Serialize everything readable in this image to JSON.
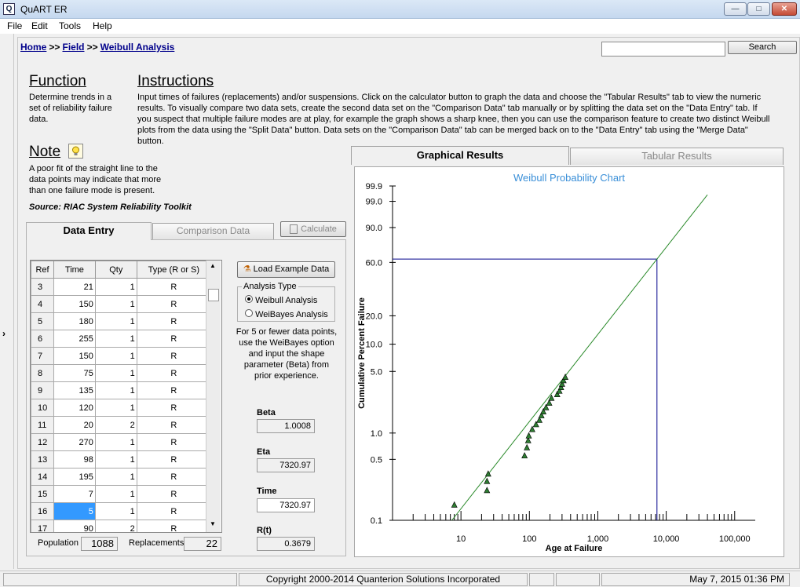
{
  "window": {
    "title": "QuART ER",
    "icon_letter": "Q",
    "minimize_glyph": "—",
    "maximize_glyph": "□",
    "close_glyph": "✕"
  },
  "menu": [
    "File",
    "Edit",
    "Tools",
    "Help"
  ],
  "breadcrumb": {
    "home": "Home",
    "field": "Field",
    "current": "Weibull Analysis",
    "separator": ">>"
  },
  "search": {
    "value": "",
    "button_label": "Search"
  },
  "function": {
    "heading": "Function",
    "text": "Determine trends in a set of reliability failure data."
  },
  "instructions": {
    "heading": "Instructions",
    "text": "Input times of failures (replacements) and/or suspensions. Click on the calculator button to graph the data and choose the \"Tabular Results\" tab to  view the numeric results. To visually compare two data sets, create the second data set on the \"Comparison Data\" tab manually or by splitting the data set on the \"Data Entry\" tab. If you suspect that multiple failure modes are at play, for example the graph shows a sharp knee, then you can use the comparison feature to create two distinct Weibull plots from the data using the \"Split Data\" button. Data sets on the \"Comparison Data\" tab can be merged back on to the \"Data Entry\" tab using the \"Merge Data\" button."
  },
  "note": {
    "heading": "Note",
    "text": "A poor fit of the straight line to the data points may indicate that more than one failure mode is present.",
    "source": "Source: RIAC System Reliability Toolkit"
  },
  "left_tabs": {
    "data_entry": "Data Entry",
    "comparison": "Comparison Data",
    "calculate": "Calculate"
  },
  "table": {
    "headers": [
      "Ref",
      "Time",
      "Qty",
      "Type (R or S)"
    ],
    "rows": [
      [
        "3",
        "21",
        "1",
        "R"
      ],
      [
        "4",
        "150",
        "1",
        "R"
      ],
      [
        "5",
        "180",
        "1",
        "R"
      ],
      [
        "6",
        "255",
        "1",
        "R"
      ],
      [
        "7",
        "150",
        "1",
        "R"
      ],
      [
        "8",
        "75",
        "1",
        "R"
      ],
      [
        "9",
        "135",
        "1",
        "R"
      ],
      [
        "10",
        "120",
        "1",
        "R"
      ],
      [
        "11",
        "20",
        "2",
        "R"
      ],
      [
        "12",
        "270",
        "1",
        "R"
      ],
      [
        "13",
        "98",
        "1",
        "R"
      ],
      [
        "14",
        "195",
        "1",
        "R"
      ],
      [
        "15",
        "7",
        "1",
        "R"
      ],
      [
        "16",
        "5",
        "1",
        "R"
      ],
      [
        "17",
        "90",
        "2",
        "R"
      ]
    ],
    "selected_ref": "16"
  },
  "population": {
    "label": "Population",
    "value": "1088"
  },
  "replacements": {
    "label": "Replacements",
    "value": "22"
  },
  "load_example": "Load Example Data",
  "analysis_type": {
    "legend": "Analysis Type",
    "options": [
      "Weibull Analysis",
      "WeiBayes Analysis"
    ],
    "selected": "Weibull Analysis"
  },
  "weibayes_hint": "For 5 or fewer data points, use the WeiBayes option and input the shape parameter (Beta) from prior experience.",
  "results": {
    "beta": {
      "label": "Beta",
      "value": "1.0008"
    },
    "eta": {
      "label": "Eta",
      "value": "7320.97"
    },
    "time": {
      "label": "Time",
      "value": "7320.97"
    },
    "rt": {
      "label": "R(t)",
      "value": "0.3679"
    }
  },
  "right_tabs": {
    "graphical": "Graphical Results",
    "tabular": "Tabular Results"
  },
  "chart_data": {
    "type": "scatter",
    "title": "Weibull Probability Chart",
    "xlabel": "Age at Failure",
    "ylabel": "Cumulative Percent Failure",
    "x_scale": "log",
    "y_scale": "weibull",
    "xlim": [
      1,
      200000
    ],
    "ylim": [
      0.1,
      99.9
    ],
    "x_ticks": [
      {
        "v": 10,
        "l": "10"
      },
      {
        "v": 100,
        "l": "100"
      },
      {
        "v": 1000,
        "l": "1,000"
      },
      {
        "v": 10000,
        "l": "10,000"
      },
      {
        "v": 100000,
        "l": "100,000"
      }
    ],
    "y_ticks": [
      {
        "v": 99.9,
        "l": "99.9"
      },
      {
        "v": 99.0,
        "l": "99.0"
      },
      {
        "v": 90.0,
        "l": "90.0"
      },
      {
        "v": 60.0,
        "l": "60.0"
      },
      {
        "v": 20.0,
        "l": "20.0"
      },
      {
        "v": 10.0,
        "l": "10.0"
      },
      {
        "v": 5.0,
        "l": "5.0"
      },
      {
        "v": 1.0,
        "l": "1.0"
      },
      {
        "v": 0.5,
        "l": "0.5"
      },
      {
        "v": 0.1,
        "l": "0.1"
      }
    ],
    "points": [
      {
        "x": 8,
        "y": 0.15
      },
      {
        "x": 24,
        "y": 0.22
      },
      {
        "x": 24,
        "y": 0.28
      },
      {
        "x": 25,
        "y": 0.34
      },
      {
        "x": 85,
        "y": 0.55
      },
      {
        "x": 92,
        "y": 0.68
      },
      {
        "x": 96,
        "y": 0.82
      },
      {
        "x": 98,
        "y": 0.93
      },
      {
        "x": 110,
        "y": 1.1
      },
      {
        "x": 125,
        "y": 1.25
      },
      {
        "x": 140,
        "y": 1.4
      },
      {
        "x": 150,
        "y": 1.58
      },
      {
        "x": 160,
        "y": 1.75
      },
      {
        "x": 175,
        "y": 1.95
      },
      {
        "x": 195,
        "y": 2.2
      },
      {
        "x": 210,
        "y": 2.5
      },
      {
        "x": 255,
        "y": 2.75
      },
      {
        "x": 275,
        "y": 3.0
      },
      {
        "x": 290,
        "y": 3.3
      },
      {
        "x": 300,
        "y": 3.6
      },
      {
        "x": 315,
        "y": 3.95
      },
      {
        "x": 335,
        "y": 4.3
      }
    ],
    "fit_line": {
      "beta": 1.0008,
      "eta": 7320.97
    },
    "reference": {
      "x": 7320.97,
      "y": 63.2
    },
    "colors": {
      "points": "#2e7d32",
      "fit": "#2a8a2a",
      "reference": "#00008b",
      "title": "#3a8fd8"
    }
  },
  "status": {
    "copyright": "Copyright 2000-2014 Quanterion Solutions Incorporated",
    "datetime": "May 7, 2015  01:36 PM"
  }
}
